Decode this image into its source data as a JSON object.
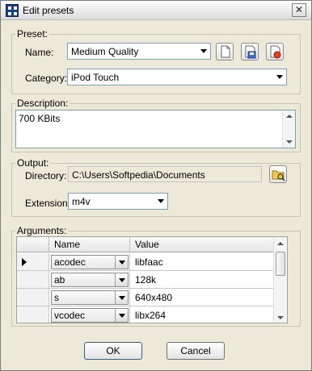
{
  "window": {
    "title": "Edit presets",
    "close_glyph": "✕"
  },
  "preset": {
    "legend": "Preset:",
    "name_label": "Name:",
    "name_value": "Medium Quality",
    "category_label": "Category:",
    "category_value": "iPod Touch",
    "icons": [
      "new-preset-icon",
      "save-preset-icon",
      "delete-preset-icon"
    ]
  },
  "description": {
    "legend": "Description:",
    "text": "700 KBits"
  },
  "output": {
    "legend": "Output:",
    "directory_label": "Directory:",
    "directory_value": "C:\\Users\\Softpedia\\Documents",
    "extension_label": "Extension:",
    "extension_value": "m4v",
    "browse_icon": "folder-browse-icon"
  },
  "arguments": {
    "legend": "Arguments:",
    "columns": [
      "Name",
      "Value"
    ],
    "rows": [
      {
        "name": "acodec",
        "value": "libfaac"
      },
      {
        "name": "ab",
        "value": "128k"
      },
      {
        "name": "s",
        "value": "640x480"
      },
      {
        "name": "vcodec",
        "value": "libx264"
      }
    ]
  },
  "buttons": {
    "ok": "OK",
    "cancel": "Cancel"
  },
  "colors": {
    "field_border": "#7f9db9",
    "button_border": "#3c5a8c"
  }
}
